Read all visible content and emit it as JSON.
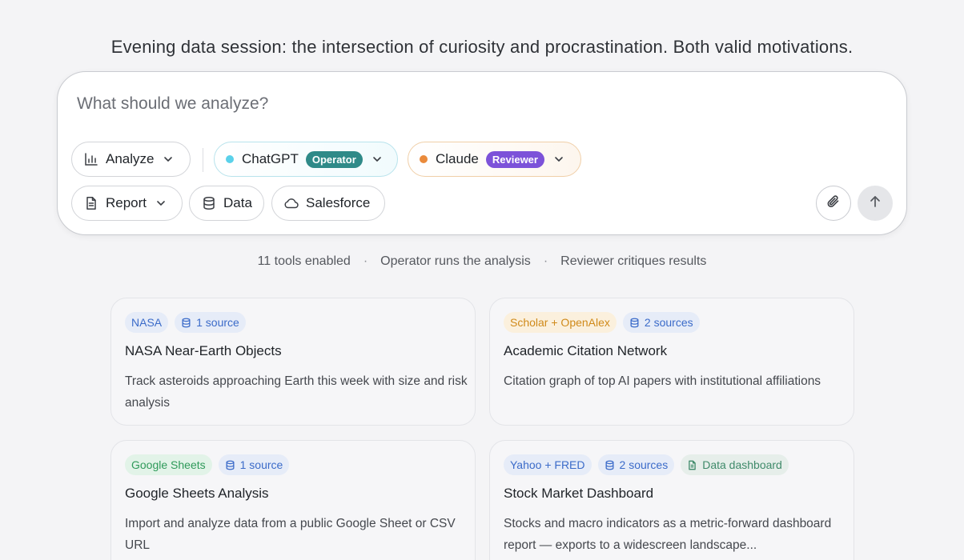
{
  "greeting": "Evening data session: the intersection of curiosity and procrastination. Both valid motivations.",
  "composer": {
    "placeholder": "What should we analyze?",
    "mode": {
      "label": "Analyze",
      "icon": "bar-chart-icon"
    },
    "operator": {
      "label": "ChatGPT",
      "badge": "Operator",
      "dot_color": "#5ad1ea",
      "badge_color": "#2f8a88"
    },
    "reviewer": {
      "label": "Claude",
      "badge": "Reviewer",
      "dot_color": "#ea8a3a",
      "badge_color": "#7c52d9"
    },
    "output": {
      "label": "Report",
      "icon": "document-icon"
    },
    "data": {
      "label": "Data",
      "icon": "database-icon"
    },
    "salesforce": {
      "label": "Salesforce",
      "icon": "cloud-icon"
    }
  },
  "meta": {
    "tools": "11 tools enabled",
    "operator_note": "Operator runs the analysis",
    "reviewer_note": "Reviewer critiques results",
    "separator": "·"
  },
  "cards": [
    {
      "tags": [
        "NASA",
        "1 source"
      ],
      "title": "NASA Near-Earth Objects",
      "desc": "Track asteroids approaching Earth this week with size and risk analysis"
    },
    {
      "tags": [
        "Scholar + OpenAlex",
        "2 sources"
      ],
      "title": "Academic Citation Network",
      "desc": "Citation graph of top AI papers with institutional affiliations"
    },
    {
      "tags": [
        "Google Sheets",
        "1 source"
      ],
      "title": "Google Sheets Analysis",
      "desc": "Import and analyze data from a public Google Sheet or CSV URL"
    },
    {
      "tags": [
        "Yahoo + FRED",
        "2 sources",
        "Data dashboard"
      ],
      "title": "Stock Market Dashboard",
      "desc": "Stocks and macro indicators as a metric-forward dashboard report — exports to a widescreen landscape..."
    }
  ]
}
